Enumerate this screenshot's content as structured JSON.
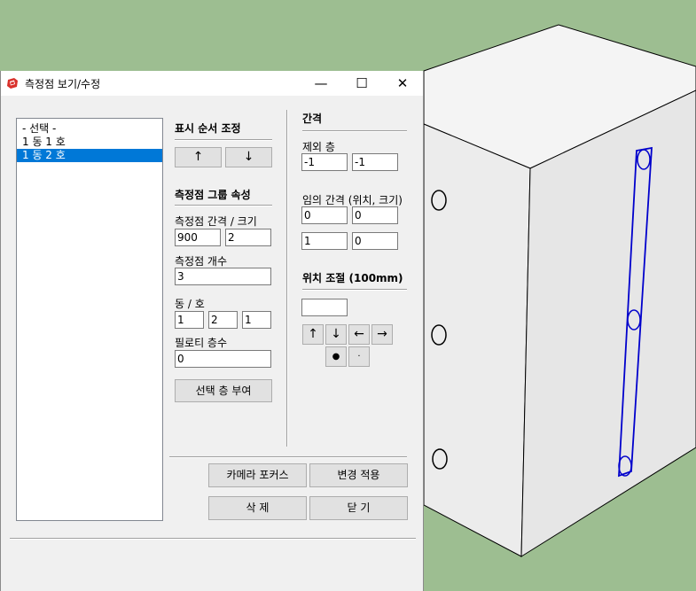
{
  "window": {
    "title": "측정점 보기/수정",
    "minimize_glyph": "—",
    "maximize_glyph": "☐",
    "close_glyph": "✕"
  },
  "list": {
    "items": [
      {
        "label": "- 선택 -",
        "selected": false
      },
      {
        "label": "1 동 1 호",
        "selected": false
      },
      {
        "label": "1 동 2 호",
        "selected": true
      }
    ]
  },
  "order": {
    "title": "표시 순서 조정",
    "up_label": "↑",
    "down_label": "↓"
  },
  "group_props": {
    "title": "측정점 그룹 속성",
    "spacing_size_label": "측정점 간격 / 크기",
    "spacing_value": "900",
    "size_value": "2",
    "count_label": "측정점 개수",
    "count_value": "3",
    "dong_ho_label": "동 / 호",
    "dong_value": "1",
    "ho_value": "2",
    "third_value": "1",
    "piloti_label": "필로티 층수",
    "piloti_value": "0",
    "assign_floor_button": "선택 층 부여"
  },
  "spacing": {
    "title": "간격",
    "exclude_floor_label": "제외 층",
    "exclude_a": "-1",
    "exclude_b": "-1",
    "arbitrary_label": "임의 간격 (위치, 크기)",
    "arb_r1_a": "0",
    "arb_r1_b": "0",
    "arb_r2_a": "1",
    "arb_r2_b": "0"
  },
  "position": {
    "title": "위치 조절 (100mm)",
    "step_value": "",
    "up": "↑",
    "down": "↓",
    "left": "←",
    "right": "→",
    "center": "●",
    "dot": "·"
  },
  "footer": {
    "camera_focus": "카메라 포커스",
    "apply_changes": "변경 적용",
    "delete": "삭 제",
    "close": "닫 기"
  },
  "colors": {
    "desktop_bg": "#9dbe91",
    "dialog_bg": "#f0f0f0",
    "selection": "#0078d7",
    "model_outline": "#0000cc"
  }
}
